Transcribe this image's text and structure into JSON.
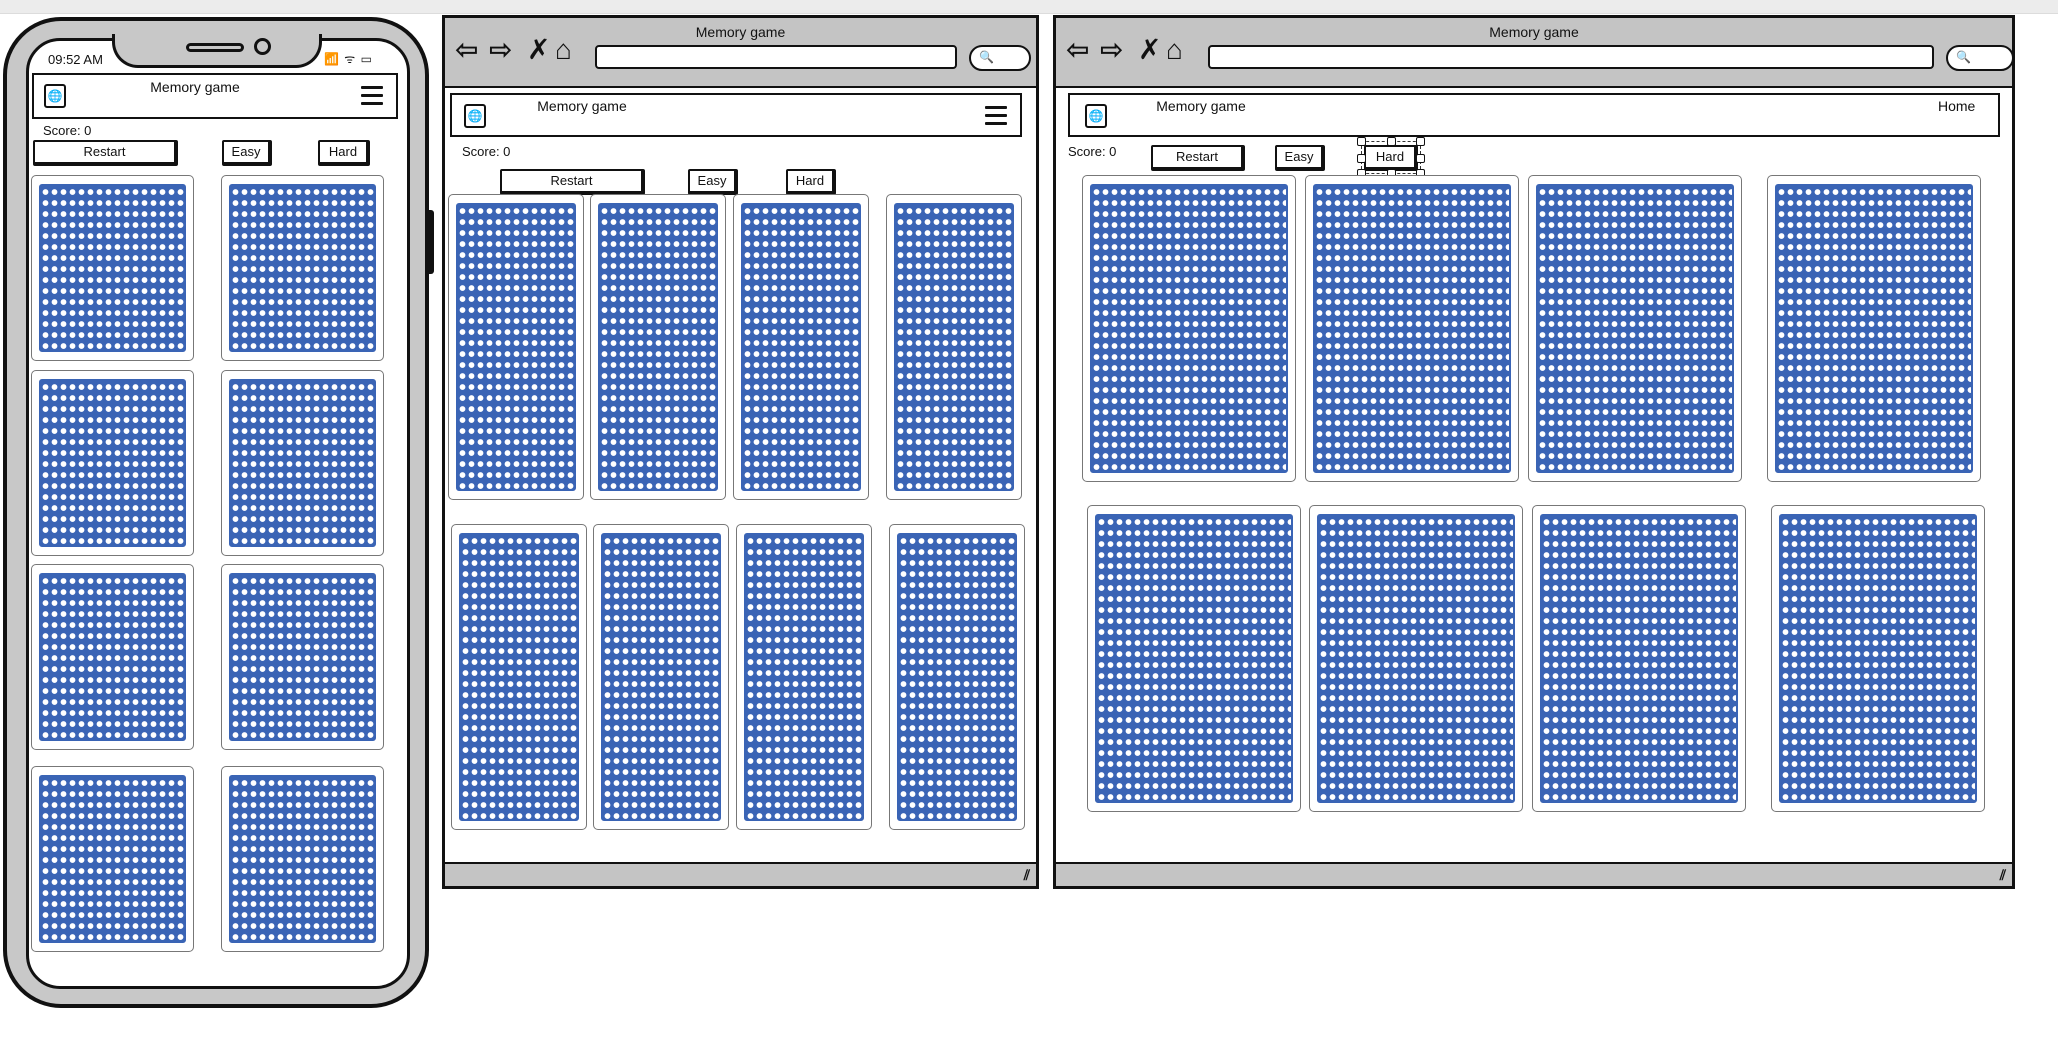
{
  "phone": {
    "time": "09:52 AM",
    "status": "📶 ᯤ ▭",
    "app_title": "Memory game",
    "score": "Score: 0",
    "buttons": {
      "restart": "Restart",
      "easy": "Easy",
      "hard": "Hard"
    }
  },
  "tablet_browser": {
    "window_title": "Memory game",
    "app_title": "Memory game",
    "score": "Score: 0",
    "buttons": {
      "restart": "Restart",
      "easy": "Easy",
      "hard": "Hard"
    }
  },
  "desktop_browser": {
    "window_title": "Memory game",
    "app_title": "Memory game",
    "nav_home": "Home",
    "score": "Score: 0",
    "buttons": {
      "restart": "Restart",
      "easy": "Easy",
      "hard": "Hard"
    }
  },
  "icons": {
    "back": "⇦",
    "forward": "⇨",
    "stop": "✗",
    "home": "⌂",
    "globe": "🌐",
    "search": "🔍",
    "resize": "⫽"
  },
  "colors": {
    "card_back": "#3a64b5",
    "chrome": "#c4c4c4"
  }
}
